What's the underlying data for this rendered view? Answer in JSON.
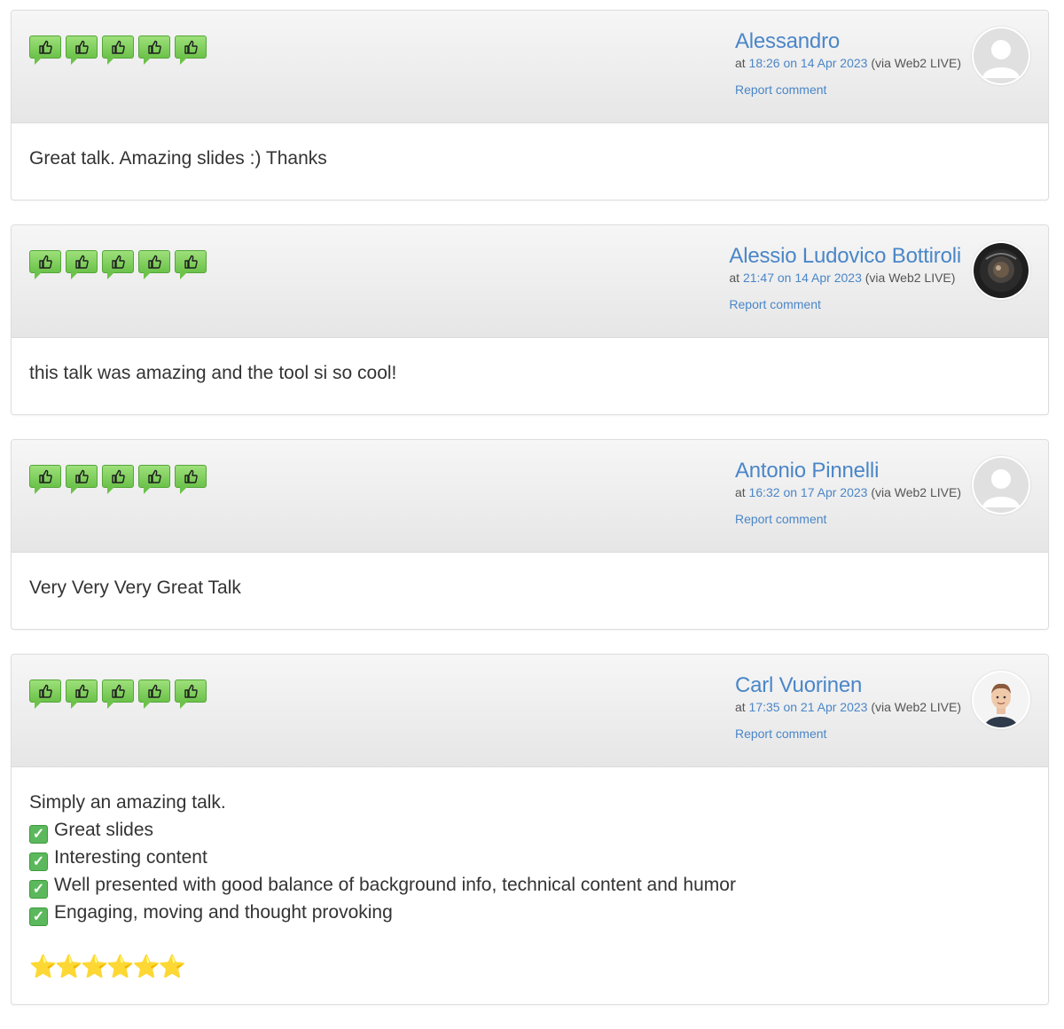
{
  "comments": [
    {
      "author": "Alessandro",
      "at_prefix": "at",
      "time_link": "18:26 on 14 Apr 2023",
      "via": "(via Web2 LIVE)",
      "report": "Report comment",
      "avatar": "default-avatar",
      "rating": 5,
      "body": [
        "Great talk. Amazing slides :) Thanks"
      ]
    },
    {
      "author": "Alessio Ludovico Bottiroli",
      "at_prefix": "at",
      "time_link": "21:47 on 14 Apr 2023",
      "via": "(via Web2 LIVE)",
      "report": "Report comment",
      "avatar": "dark-photo-avatar",
      "rating": 5,
      "body": [
        "this talk was amazing and the tool si so cool!"
      ]
    },
    {
      "author": "Antonio Pinnelli",
      "at_prefix": "at",
      "time_link": "16:32 on 17 Apr 2023",
      "via": "(via Web2 LIVE)",
      "report": "Report comment",
      "avatar": "default-avatar",
      "rating": 5,
      "body": [
        "Very Very Very Great Talk"
      ]
    },
    {
      "author": "Carl Vuorinen",
      "at_prefix": "at",
      "time_link": "17:35 on 21 Apr 2023",
      "via": "(via Web2 LIVE)",
      "report": "Report comment",
      "avatar": "person-photo-avatar",
      "rating": 5,
      "body": [
        "Simply an amazing talk.",
        "Great slides",
        "Interesting content",
        "Well presented with good balance of background info, technical content and humor",
        "Engaging, moving and thought provoking"
      ],
      "checklist_from": 1,
      "stars": "⭐⭐⭐⭐⭐⭐"
    }
  ],
  "colors": {
    "link": "#4a86c8",
    "thumb_green": "#6cc24a",
    "check_green": "#5cb85c",
    "star_gold": "#f5c11a"
  },
  "icons": {
    "rating": "thumbs-up-icon",
    "check": "check-box-icon"
  }
}
